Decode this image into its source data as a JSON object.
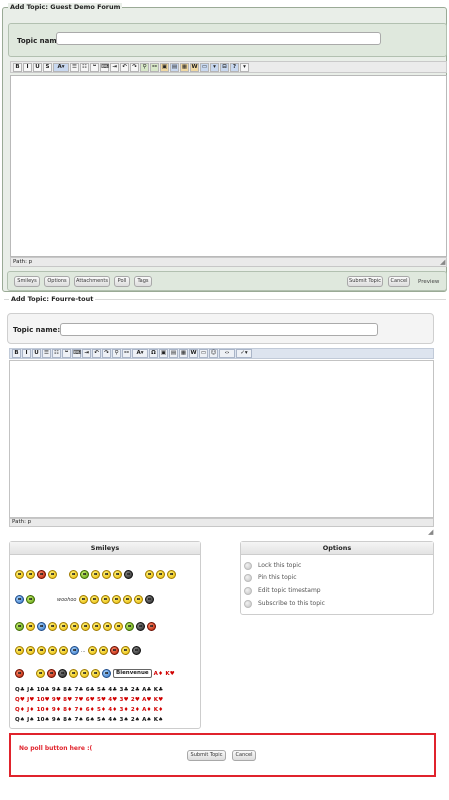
{
  "form1": {
    "legend": "Add Topic: Guest Demo Forum",
    "topic_label": "Topic name:",
    "topic_value": "",
    "toolbar": [
      {
        "icon": "bold-icon",
        "glyph": "B"
      },
      {
        "icon": "italic-icon",
        "glyph": "I"
      },
      {
        "icon": "underline-icon",
        "glyph": "U"
      },
      {
        "icon": "strikethrough-icon",
        "glyph": "S"
      },
      {
        "icon": "font-color-icon",
        "glyph": "A▾"
      },
      {
        "icon": "bullet-list-icon",
        "glyph": "☰"
      },
      {
        "icon": "numbered-list-icon",
        "glyph": "☷"
      },
      {
        "icon": "quote-icon",
        "glyph": "❝"
      },
      {
        "icon": "code-icon",
        "glyph": "⌨"
      },
      {
        "icon": "indent-icon",
        "glyph": "⇥"
      },
      {
        "icon": "undo-icon",
        "glyph": "↶"
      },
      {
        "icon": "redo-icon",
        "glyph": "↷"
      },
      {
        "icon": "link-icon",
        "glyph": "⚲"
      },
      {
        "icon": "unlink-icon",
        "glyph": "⚯"
      },
      {
        "icon": "image-icon",
        "glyph": "▣"
      },
      {
        "icon": "table-icon",
        "glyph": "▤"
      },
      {
        "icon": "paste-icon",
        "glyph": "▦"
      },
      {
        "icon": "paste-word-icon",
        "glyph": "W"
      },
      {
        "icon": "media-icon",
        "glyph": "▭"
      },
      {
        "icon": "emoticon-icon",
        "glyph": "▾"
      },
      {
        "icon": "source-icon",
        "glyph": "⊟"
      },
      {
        "icon": "help-icon",
        "glyph": "?"
      },
      {
        "icon": "format-dropdown-icon",
        "glyph": "▾"
      }
    ],
    "path": "Path: p",
    "buttons": {
      "smileys": "Smileys",
      "options": "Options",
      "attachments": "Attachments",
      "poll": "Poll",
      "tags": "Tags",
      "submit": "Submit Topic",
      "cancel": "Cancel",
      "preview": "Preview"
    }
  },
  "form2": {
    "legend": "Add Topic: Fourre-tout",
    "topic_label": "Topic name:",
    "topic_value": "",
    "toolbar": [
      {
        "icon": "bold-icon",
        "glyph": "B"
      },
      {
        "icon": "italic-icon",
        "glyph": "I"
      },
      {
        "icon": "underline-icon",
        "glyph": "U"
      },
      {
        "icon": "bullet-list-icon",
        "glyph": "☰"
      },
      {
        "icon": "numbered-list-icon",
        "glyph": "☷"
      },
      {
        "icon": "quote-icon",
        "glyph": "❝"
      },
      {
        "icon": "code-icon",
        "glyph": "⌨"
      },
      {
        "icon": "indent-icon",
        "glyph": "⇥"
      },
      {
        "icon": "undo-icon",
        "glyph": "↶"
      },
      {
        "icon": "redo-icon",
        "glyph": "↷"
      },
      {
        "icon": "link-icon",
        "glyph": "⚲"
      },
      {
        "icon": "unlink-icon",
        "glyph": "⚯"
      },
      {
        "icon": "font-color-icon",
        "glyph": "A▾"
      },
      {
        "icon": "omega-icon",
        "glyph": "Ω"
      },
      {
        "icon": "image-icon",
        "glyph": "▣"
      },
      {
        "icon": "table-icon",
        "glyph": "▤"
      },
      {
        "icon": "paste-icon",
        "glyph": "▦"
      },
      {
        "icon": "paste-word-icon",
        "glyph": "W"
      },
      {
        "icon": "media-icon",
        "glyph": "▭"
      },
      {
        "icon": "emoticon-icon",
        "glyph": "☺"
      },
      {
        "icon": "html-icon",
        "glyph": "‹›"
      },
      {
        "icon": "spellcheck-icon",
        "glyph": "✓▾"
      }
    ],
    "path": "Path: p",
    "smileys_title": "Smileys",
    "options_title": "Options",
    "options": [
      "Lock this topic",
      "Pin this topic",
      "Edit topic timestamp",
      "Subscribe to this topic"
    ],
    "smiley_speech": [
      "woohoo",
      "..."
    ],
    "smiley_banner": "Bienvenue",
    "smiley_cards_inline": [
      "A♦",
      "K♥"
    ],
    "card_rows": [
      "Q♣ J♣ 10♣ 9♣ 8♣ 7♣ 6♣ 5♣ 4♣ 3♣ 2♣ A♣ K♣",
      "Q♥ J♥ 10♥ 9♥ 8♥ 7♥ 6♥ 5♥ 4♥ 3♥ 2♥ A♥ K♥",
      "Q♦ J♦ 10♦ 9♦ 8♦ 7♦ 6♦ 5♦ 4♦ 3♦ 2♦ A♦ K♦",
      "Q♠ J♠ 10♠ 9♠ 8♠ 7♠ 6♠ 5♠ 4♠ 3♠ 2♠ A♠ K♠"
    ],
    "annotation": "No poll button here :(",
    "submit": "Submit Topic",
    "cancel": "Cancel"
  },
  "colors": {
    "form1_bg": "#e9eee8",
    "highlight_border": "#e0232c",
    "card_red": "#d00000"
  }
}
